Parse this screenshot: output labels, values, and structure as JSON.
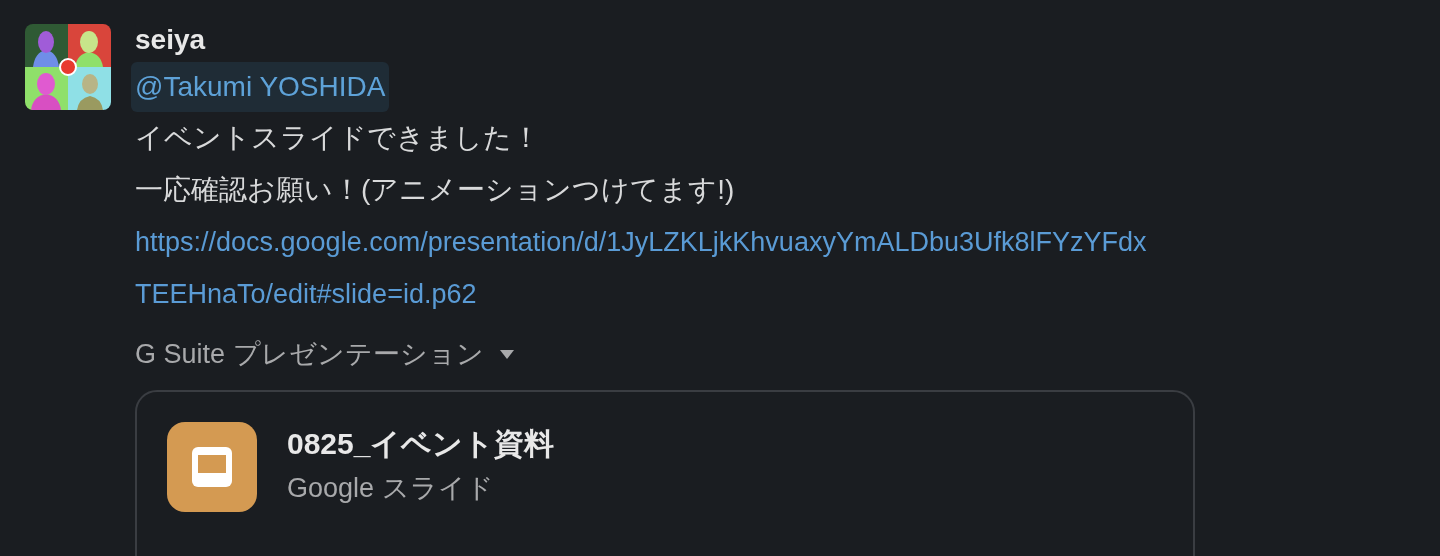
{
  "message": {
    "author": "seiya",
    "mention": "@Takumi YOSHIDA",
    "lines": [
      "イベントスライドできました！",
      "一応確認お願い！(アニメーションつけてます!)"
    ],
    "link_lines": [
      "https://docs.google.com/presentation/d/1JyLZKLjkKhvuaxyYmALDbu3Ufk8lFYzYFdx",
      "TEEHnaTo/edit#slide=id.p62"
    ],
    "attachment_source": "G Suite プレゼンテーション",
    "attachment": {
      "title": "0825_イベント資料",
      "subtitle": "Google スライド"
    }
  }
}
